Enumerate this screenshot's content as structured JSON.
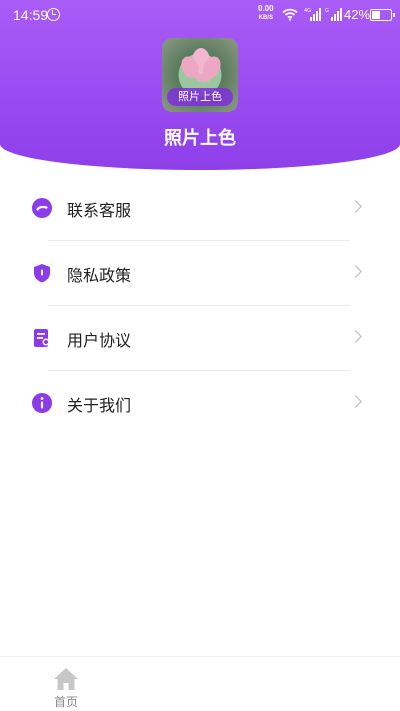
{
  "status_bar": {
    "time": "14:59",
    "net_speed_value": "0.00",
    "net_speed_unit": "KB/S",
    "sig1_label": "4G",
    "sig2_label": "G",
    "battery": "42%",
    "battery_level": 0.42
  },
  "app": {
    "icon_badge": "照片上色",
    "title": "照片上色"
  },
  "menu": {
    "items": [
      {
        "label": "联系客服",
        "icon": "customer-service-icon"
      },
      {
        "label": "隐私政策",
        "icon": "shield-icon"
      },
      {
        "label": "用户协议",
        "icon": "document-icon"
      },
      {
        "label": "关于我们",
        "icon": "info-icon"
      }
    ]
  },
  "tabbar": {
    "home_label": "首页"
  },
  "colors": {
    "header_gradient_top": "#a95cf6",
    "header_gradient_bottom": "#8e3fe8",
    "icon_accent": "#8c3be9"
  }
}
